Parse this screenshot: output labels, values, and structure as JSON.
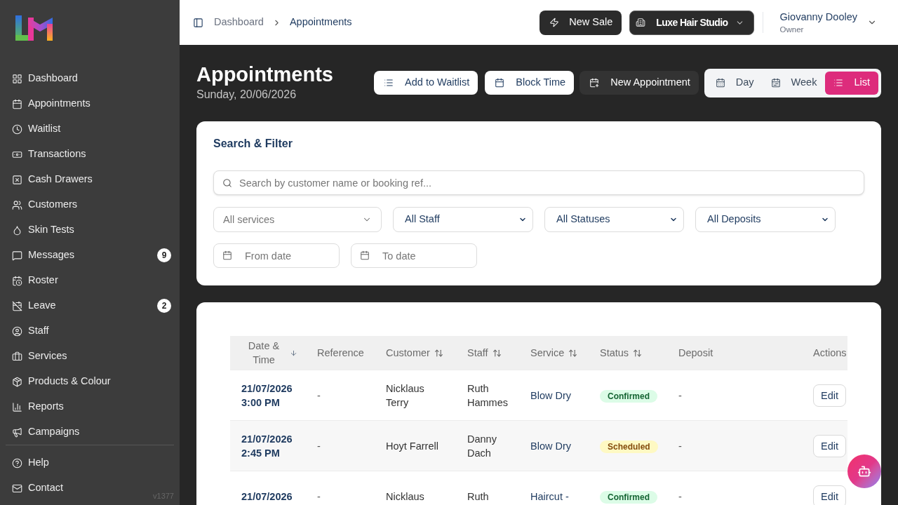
{
  "sidebar": {
    "items": [
      {
        "label": "Dashboard"
      },
      {
        "label": "Appointments"
      },
      {
        "label": "Waitlist"
      },
      {
        "label": "Transactions"
      },
      {
        "label": "Cash Drawers"
      },
      {
        "label": "Customers"
      },
      {
        "label": "Skin Tests"
      },
      {
        "label": "Messages",
        "badge": "9"
      },
      {
        "label": "Roster"
      },
      {
        "label": "Leave",
        "badge": "2"
      },
      {
        "label": "Staff"
      },
      {
        "label": "Services"
      },
      {
        "label": "Products & Colour"
      },
      {
        "label": "Reports"
      },
      {
        "label": "Campaigns"
      }
    ],
    "footer_items": [
      {
        "label": "Help"
      },
      {
        "label": "Contact"
      }
    ],
    "version": "v1377"
  },
  "header": {
    "breadcrumb": [
      {
        "label": "Dashboard",
        "current": false
      },
      {
        "label": "Appointments",
        "current": true
      }
    ],
    "new_sale": "New Sale",
    "location": "Luxe Hair Studio",
    "user": {
      "name": "Giovanny Dooley",
      "role": "Owner"
    }
  },
  "page": {
    "title": "Appointments",
    "date": "Sunday, 20/06/2026",
    "actions": [
      {
        "label": "Add to Waitlist",
        "kind": "light"
      },
      {
        "label": "Block Time",
        "kind": "light"
      },
      {
        "label": "New Appointment",
        "kind": "dark"
      }
    ],
    "views": [
      {
        "label": "Day",
        "selected": false
      },
      {
        "label": "Week",
        "selected": false
      },
      {
        "label": "List",
        "selected": true
      }
    ]
  },
  "filters": {
    "title": "Search & Filter",
    "search": {
      "placeholder": "Search by customer name or booking ref..."
    },
    "selects": [
      {
        "kind": "combobox",
        "placeholder": "All services"
      },
      {
        "kind": "native",
        "value": "All Staff"
      },
      {
        "kind": "native",
        "value": "All Statuses"
      },
      {
        "kind": "native",
        "value": "All Deposits"
      }
    ],
    "dates": [
      {
        "placeholder": "From date"
      },
      {
        "placeholder": "To date"
      }
    ]
  },
  "appointments": {
    "columns": [
      {
        "label": "Date & Time",
        "sorted": true
      },
      {
        "label": "Reference"
      },
      {
        "label": "Customer",
        "sorted": false
      },
      {
        "label": "Staff",
        "sorted": false
      },
      {
        "label": "Service",
        "sorted": false
      },
      {
        "label": "Status",
        "sorted": false
      },
      {
        "label": "Deposit"
      },
      {
        "label": "Actions"
      }
    ],
    "rows": [
      {
        "date": "21/07/2026",
        "time": "3:00 PM",
        "reference": "-",
        "customer": "Nicklaus Terry",
        "staff": "Ruth Hammes",
        "service": "Blow Dry",
        "status": {
          "label": "Confirmed",
          "kind": "confirmed"
        },
        "deposit": "-",
        "action": "Edit"
      },
      {
        "date": "21/07/2026",
        "time": "2:45 PM",
        "reference": "-",
        "customer": "Hoyt Farrell",
        "staff": "Danny Dach",
        "service": "Blow Dry",
        "status": {
          "label": "Scheduled",
          "kind": "scheduled"
        },
        "deposit": "-",
        "action": "Edit"
      },
      {
        "date": "21/07/2026",
        "reference": "-",
        "customer": "Nicklaus",
        "staff": "Ruth",
        "service": "Haircut -",
        "status": {
          "label": "Confirmed",
          "kind": "confirmed"
        },
        "deposit": "-",
        "action": "Edit"
      }
    ]
  }
}
